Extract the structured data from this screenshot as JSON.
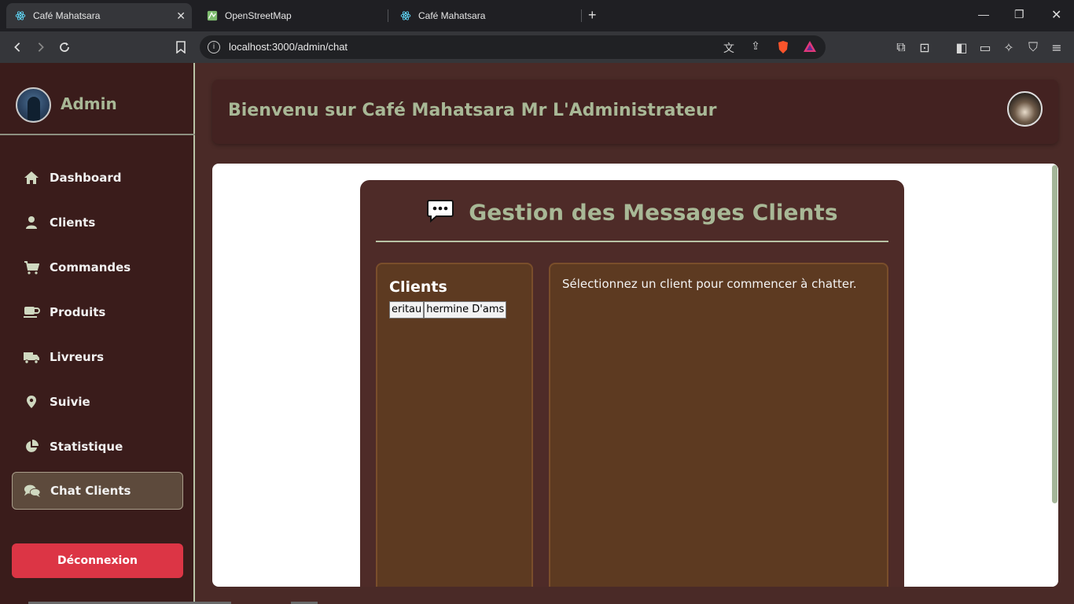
{
  "browser": {
    "tabs": [
      {
        "title": "Café Mahatsara",
        "icon": "react-icon",
        "active": true
      },
      {
        "title": "OpenStreetMap",
        "icon": "map-icon",
        "active": false
      },
      {
        "title": "Café Mahatsara",
        "icon": "react-icon",
        "active": false
      }
    ],
    "url": "localhost:3000/admin/chat"
  },
  "sidebar": {
    "title": "Admin",
    "items": [
      {
        "label": "Dashboard",
        "icon": "home-icon"
      },
      {
        "label": "Clients",
        "icon": "user-icon"
      },
      {
        "label": "Commandes",
        "icon": "cart-icon"
      },
      {
        "label": "Produits",
        "icon": "mug-icon"
      },
      {
        "label": "Livreurs",
        "icon": "truck-icon"
      },
      {
        "label": "Suivie",
        "icon": "location-pin-icon"
      },
      {
        "label": "Statistique",
        "icon": "pie-chart-icon"
      },
      {
        "label": "Chat Clients",
        "icon": "chat-bubbles-icon",
        "active": true
      }
    ],
    "logout_label": "Déconnexion"
  },
  "header": {
    "title": "Bienvenu sur Café Mahatsara Mr L'Administrateur"
  },
  "chat_panel": {
    "title": "Gestion des Messages Clients",
    "clients_heading": "Clients",
    "clients": [
      "eritau",
      "hermine D'ams"
    ],
    "placeholder": "Sélectionnez un client pour commencer à chatter."
  },
  "colors": {
    "accent": "#a8b896",
    "sidebar_bg": "#3a1c1b",
    "logout": "#dc3545",
    "panel_bg": "#4e2b28",
    "box_bg": "#5d3a21"
  }
}
